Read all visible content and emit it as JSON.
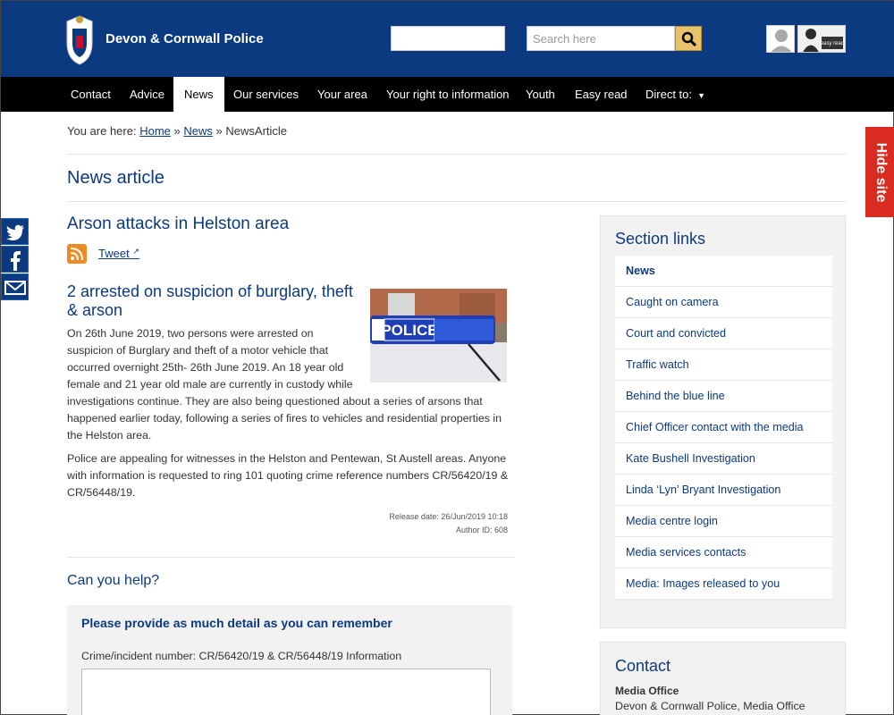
{
  "header": {
    "site_name": "Devon & Cornwall Police",
    "search_placeholder": "Search here",
    "easy_read_label": "easy read"
  },
  "nav": {
    "items": [
      "Contact",
      "Advice",
      "News",
      "Our services",
      "Your area",
      "Your right to information",
      "Youth",
      "Easy read",
      "Direct to:"
    ],
    "active": "News"
  },
  "hide_site": "Hide site",
  "breadcrumb": {
    "prefix": "You are here:",
    "home": "Home",
    "sep": "»",
    "news": "News",
    "current": "NewsArticle"
  },
  "page_title": "News article",
  "article": {
    "title": "Arson attacks in Helston area",
    "tweet_label": "Tweet",
    "image_label": "POLICE",
    "headline": "2 arrested on suspicion of burglary, theft & arson",
    "para1_a": "On 26th June 2019, two persons were arrested on suspicion of Burglary and theft of a motor vehicle that occurred overnight 25th- 26th June 2019. An 18 year old female and 21 year old male are currently in custody while",
    "para1_b": "investigations continue. They are also being questioned about a series of arsons that happened earlier today, following a series of fires to vehicles and residential properties in the Helston area.",
    "para2": "Police are appealing for witnesses in the Helston and Pentewan, St Austell areas. Anyone with information is requested to ring 101 quoting crime reference numbers CR/56420/19 & CR/56448/19.",
    "release_date": "Release date: 26/Jun/2019 10:18",
    "author_id": "Author ID: 608"
  },
  "help": {
    "title": "Can you help?",
    "form_heading": "Please provide as much detail as you can remember",
    "field_label": "Crime/incident number: CR/56420/19 & CR/56448/19 Information"
  },
  "section_links": {
    "title": "Section links",
    "items": [
      "News",
      "Caught on camera",
      "Court and convicted",
      "Traffic watch",
      "Behind the blue line",
      "Chief Officer contact with the media",
      "Kate Bushell Investigation",
      "Linda ‘Lyn’ Bryant Investigation",
      "Media centre login",
      "Media services contacts",
      "Media: Images released to you"
    ]
  },
  "contact": {
    "title": "Contact",
    "subtitle": "Media Office",
    "line1": "Devon & Cornwall Police, Media Office"
  },
  "colors": {
    "brand_blue": "#0b3a80",
    "hide_red": "#d92b1f",
    "search_gold": "#e8c36a",
    "rss_orange": "#f08a24"
  }
}
